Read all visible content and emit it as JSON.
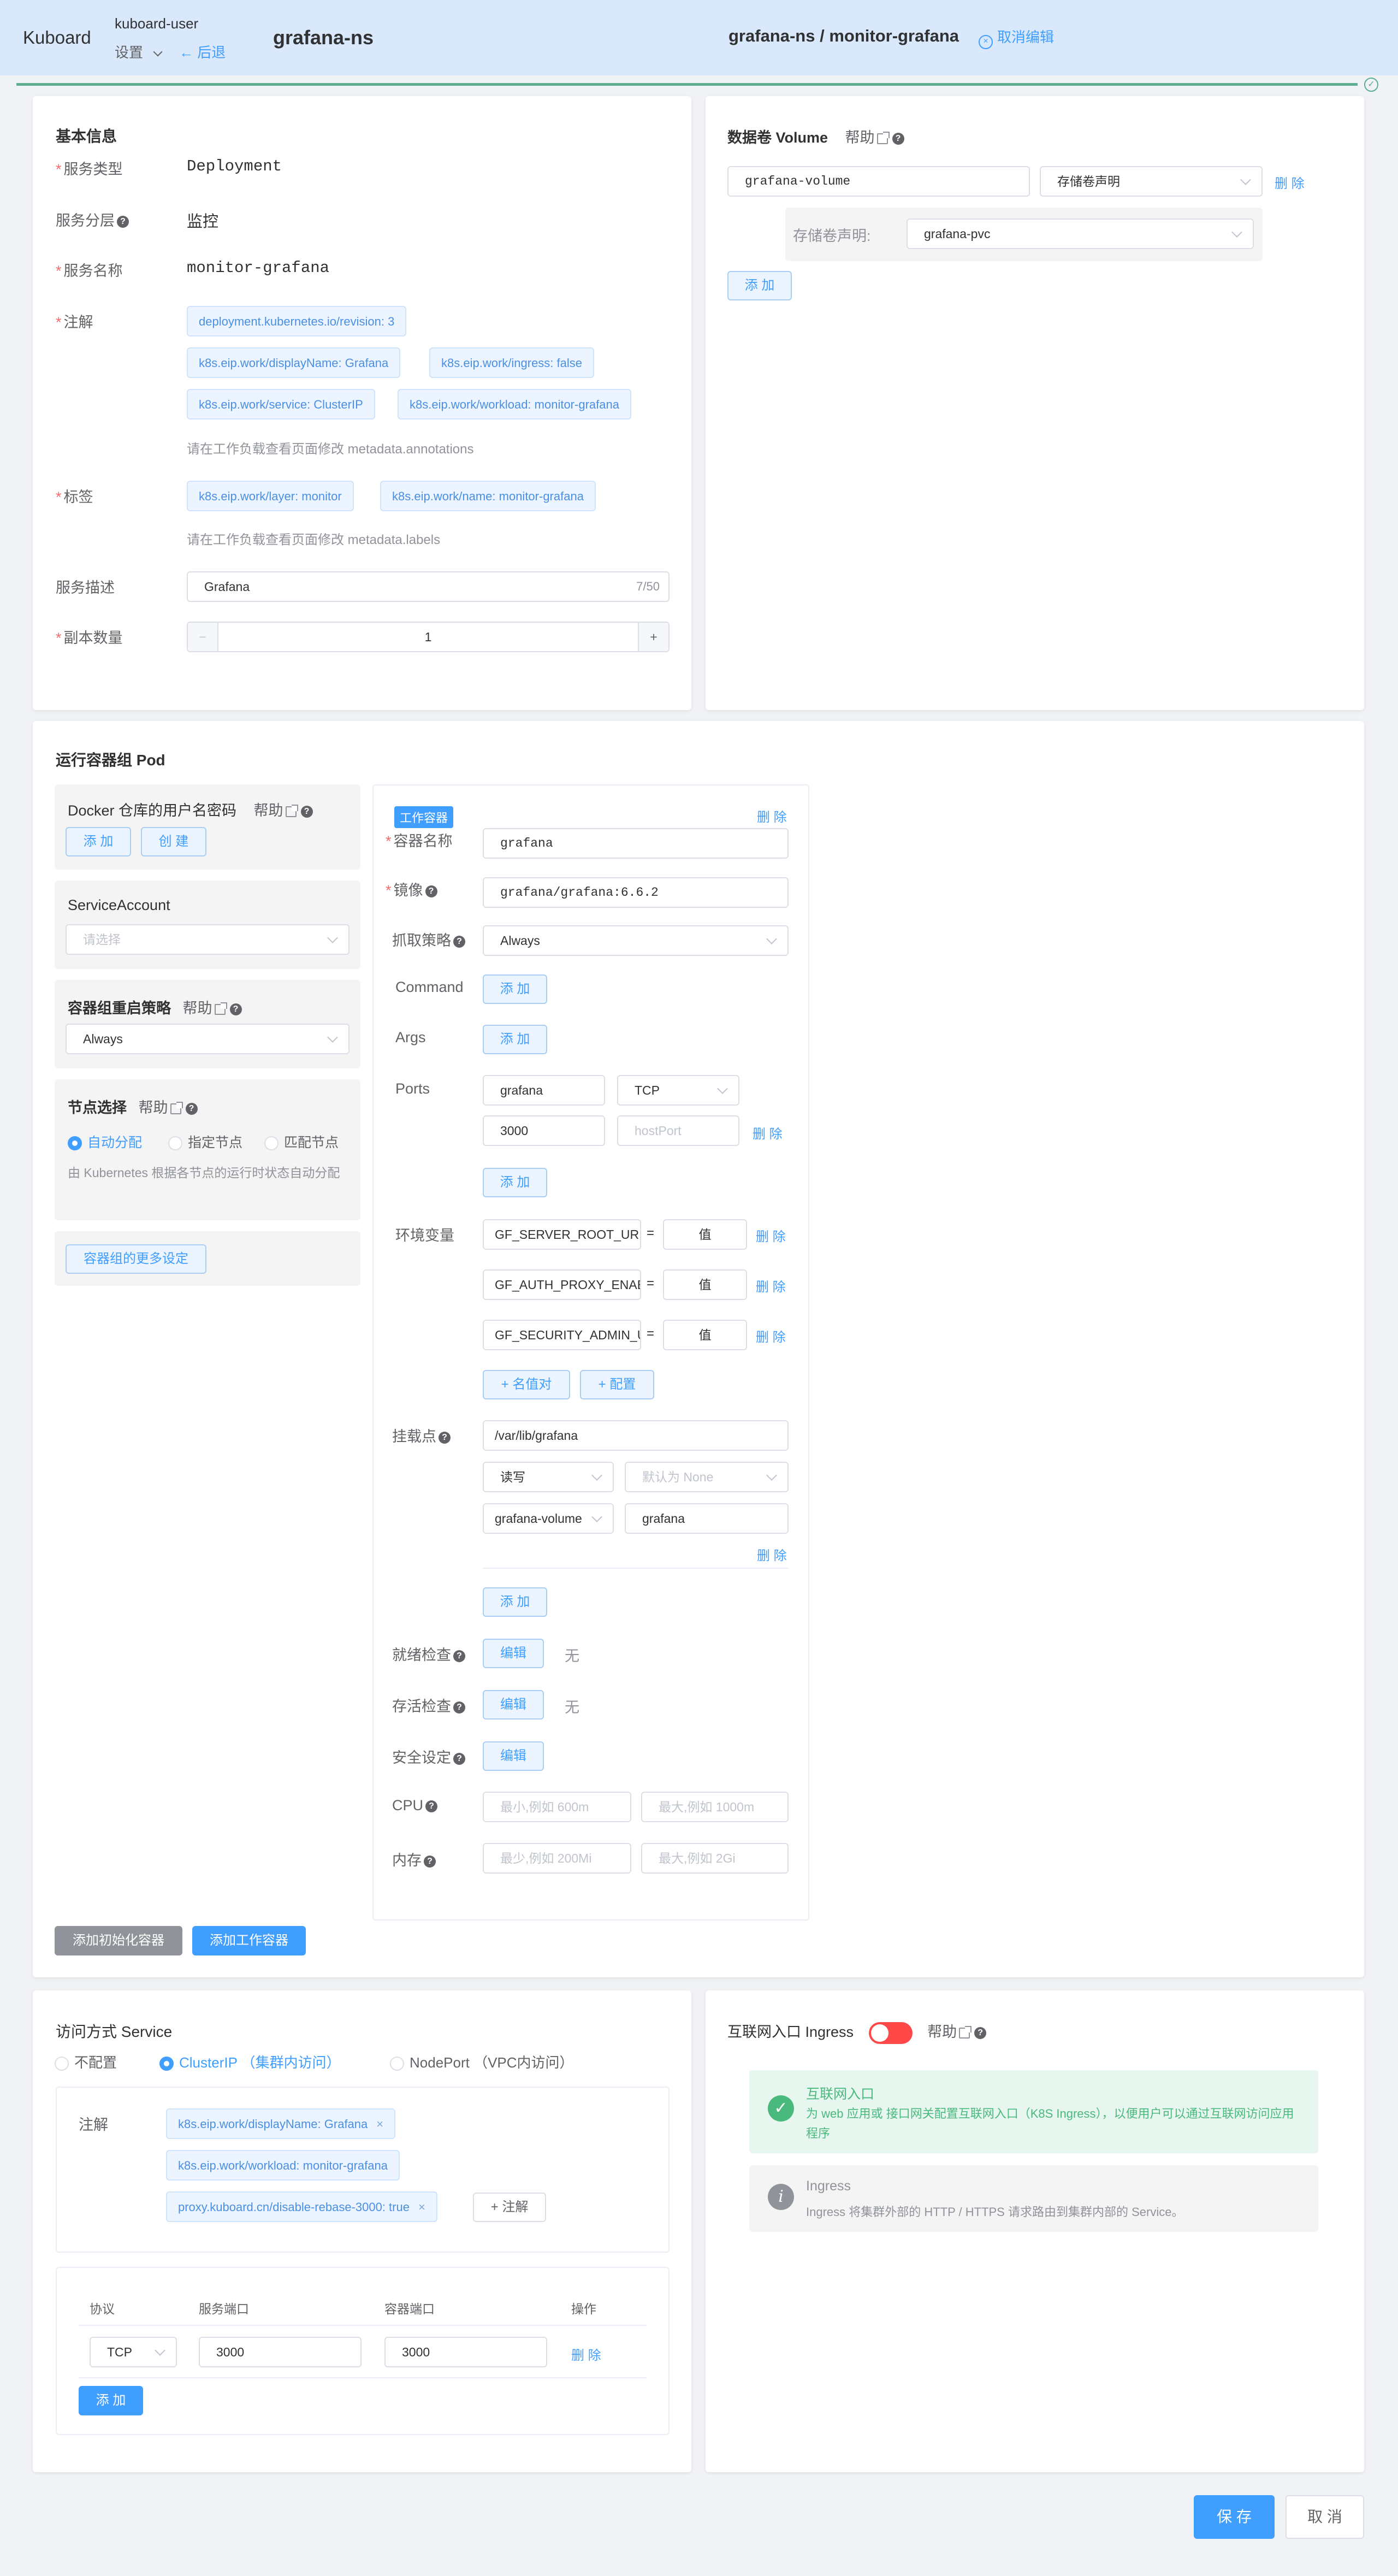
{
  "header": {
    "logo": "Kuboard",
    "user": "kuboard-user",
    "settings": "设置",
    "back": "后退",
    "namespace": "grafana-ns",
    "path": "grafana-ns / monitor-grafana",
    "cancel_edit": "取消编辑"
  },
  "basic": {
    "title": "基本信息",
    "type_label": "服务类型",
    "type_value": "Deployment",
    "layer_label": "服务分层",
    "layer_value": "监控",
    "name_label": "服务名称",
    "name_value": "monitor-grafana",
    "annot_label": "注解",
    "annotations": [
      "deployment.kubernetes.io/revision: 3",
      "k8s.eip.work/displayName: Grafana",
      "k8s.eip.work/ingress: false",
      "k8s.eip.work/service: ClusterIP",
      "k8s.eip.work/workload: monitor-grafana"
    ],
    "annot_hint": "请在工作负载查看页面修改 metadata.annotations",
    "labels_label": "标签",
    "labels": [
      "k8s.eip.work/layer: monitor",
      "k8s.eip.work/name: monitor-grafana"
    ],
    "labels_hint": "请在工作负载查看页面修改 metadata.labels",
    "desc_label": "服务描述",
    "desc_value": "Grafana",
    "desc_count": "7/50",
    "replicas_label": "副本数量",
    "replicas_value": "1",
    "minus": "−",
    "plus": "+"
  },
  "volume": {
    "title": "数据卷 Volume",
    "help": "帮助",
    "name": "grafana-volume",
    "type": "存储卷声明",
    "delete": "删 除",
    "pvc_label": "存储卷声明:",
    "pvc_value": "grafana-pvc",
    "add": "添 加"
  },
  "pod": {
    "title": "运行容器组 Pod",
    "docker_title": "Docker 仓库的用户名密码",
    "help": "帮助",
    "add": "添 加",
    "create": "创 建",
    "sa_title": "ServiceAccount",
    "sa_placeholder": "请选择",
    "restart_title": "容器组重启策略",
    "restart_value": "Always",
    "node_title": "节点选择",
    "node_opts": [
      "自动分配",
      "指定节点",
      "匹配节点"
    ],
    "node_hint": "由 Kubernetes 根据各节点的运行时状态自动分配",
    "more": "容器组的更多设定",
    "add_init": "添加初始化容器",
    "add_work": "添加工作容器"
  },
  "container": {
    "badge": "工作容器",
    "delete": "删 除",
    "name_label": "容器名称",
    "name_value": "grafana",
    "image_label": "镜像",
    "image_value": "grafana/grafana:6.6.2",
    "pull_label": "抓取策略",
    "pull_value": "Always",
    "command_label": "Command",
    "args_label": "Args",
    "add": "添 加",
    "ports_label": "Ports",
    "port_name": "grafana",
    "protocol": "TCP",
    "port": "3000",
    "hostport_ph": "hostPort",
    "env_label": "环境变量",
    "env": [
      {
        "name": "GF_SERVER_ROOT_URL",
        "value": "值"
      },
      {
        "name": "GF_AUTH_PROXY_ENABLED",
        "value": "值"
      },
      {
        "name": "GF_SECURITY_ADMIN_USER",
        "value": "值"
      }
    ],
    "eq": "=",
    "add_kv": "+ 名值对",
    "add_cfg": "+ 配置",
    "mount_label": "挂载点",
    "mount_path": "/var/lib/grafana",
    "mount_mode": "读写",
    "mount_prop_ph": "默认为 None",
    "mount_vol": "grafana-volume",
    "mount_sub": "grafana",
    "ready_label": "就绪检查",
    "live_label": "存活检查",
    "sec_label": "安全设定",
    "edit": "编辑",
    "none": "无",
    "cpu_label": "CPU",
    "cpu_min": "最小,例如 600m",
    "cpu_max": "最大,例如 1000m",
    "mem_label": "内存",
    "mem_min": "最少,例如 200Mi",
    "mem_max": "最大,例如 2Gi"
  },
  "service": {
    "title": "访问方式 Service",
    "opts": [
      "不配置",
      "ClusterIP （集群内访问）",
      "NodePort （VPC内访问）"
    ],
    "annot_label": "注解",
    "annotations": [
      "k8s.eip.work/displayName: Grafana",
      "k8s.eip.work/workload: monitor-grafana",
      "proxy.kuboard.cn/disable-rebase-3000: true"
    ],
    "add_annot": "+ 注解",
    "cols": [
      "协议",
      "服务端口",
      "容器端口",
      "操作"
    ],
    "protocol": "TCP",
    "svc_port": "3000",
    "ctr_port": "3000",
    "delete": "删 除",
    "add": "添 加"
  },
  "ingress": {
    "title": "互联网入口 Ingress",
    "help": "帮助",
    "tip1_title": "互联网入口",
    "tip1_text": "为 web 应用或 接口网关配置互联网入口（K8S Ingress），以便用户可以通过互联网访问应用程序",
    "tip2_title": "Ingress",
    "tip2_text": "Ingress 将集群外部的 HTTP / HTTPS 请求路由到集群内部的 Service。"
  },
  "footer": {
    "save": "保 存",
    "cancel": "取 消"
  },
  "colors": {
    "primary": "#409eff",
    "header": "#d9e8fb",
    "success": "#67c23a",
    "danger": "#f56c6c"
  }
}
